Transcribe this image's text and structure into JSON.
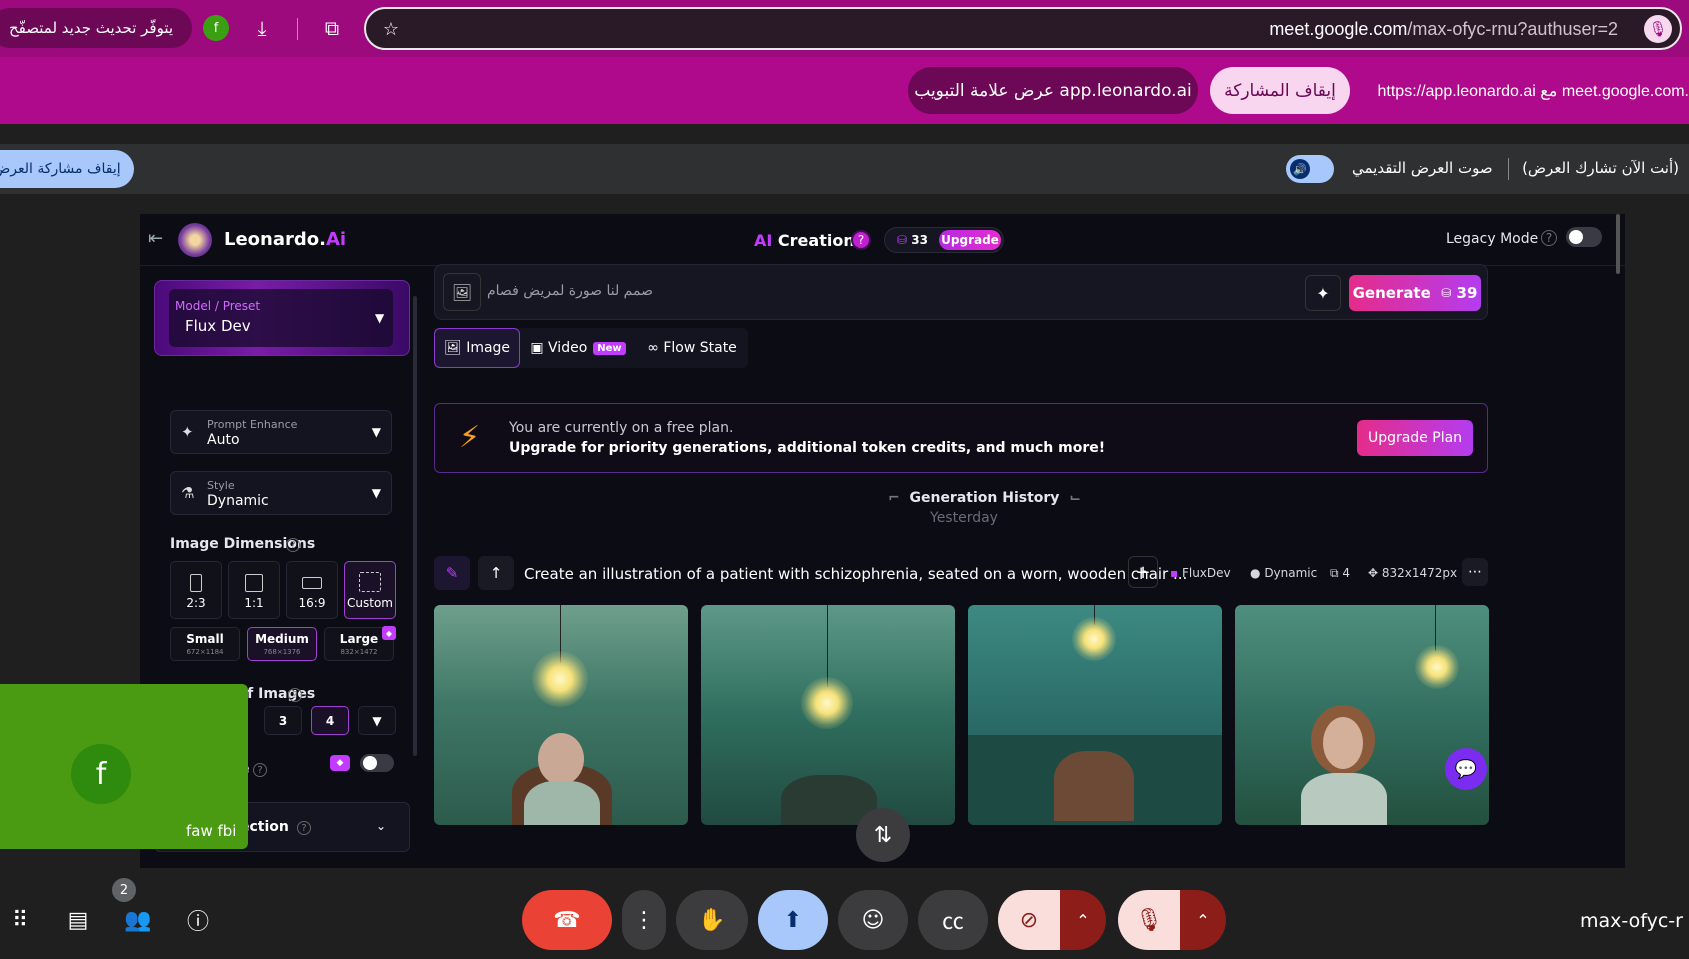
{
  "browser": {
    "update_text": "يتوفّر تحديث جديد لمتصفّح",
    "profile_initial": "f",
    "url_host": "meet.google.com",
    "url_path": "/max-ofyc-rnu?authuser=2"
  },
  "share_bar": {
    "info": "https://app.leonardo.ai مع meet.google.com.",
    "stop_button": "إيقاف المشاركة",
    "show_tab_button": "عرض علامة التبويب app.leonardo.ai"
  },
  "meet_strip": {
    "stop_presenting": "إيقاف مشاركة العرض",
    "presenting_text": "(أنت الآن تشارك العرض)",
    "presentation_audio": "صوت العرض التقديمي"
  },
  "leonardo": {
    "brand_main": "Leonardo.",
    "brand_ai": "Ai",
    "creation_ai": "AI",
    "creation": " Creation",
    "help_mark": "?",
    "tokens": "33",
    "upgrade": "Upgrade",
    "legacy_mode": "Legacy Mode",
    "sidebar": {
      "model_label": "Model / Preset",
      "model_value": "Flux Dev",
      "prompt_enhance_label": "Prompt Enhance",
      "prompt_enhance_value": "Auto",
      "style_label": "Style",
      "style_value": "Dynamic",
      "image_dimensions": "Image Dimensions",
      "ratios": [
        "2:3",
        "1:1",
        "16:9",
        "Custom"
      ],
      "sizes": [
        {
          "name": "Small",
          "dims": "672×1184"
        },
        {
          "name": "Medium",
          "dims": "768×1376"
        },
        {
          "name": "Large",
          "dims": "832×1472"
        }
      ],
      "number_of_images": "Number of Images",
      "num_options": [
        "3",
        "4"
      ],
      "private_label": "e",
      "content_section": "ection"
    },
    "prompt": {
      "placeholder": "صمم لنا صورة لمريض فصام",
      "generate": "Generate",
      "generate_cost": "39"
    },
    "tabs": [
      {
        "label": "Image"
      },
      {
        "label": "Video",
        "badge": "New"
      },
      {
        "label": "Flow State"
      }
    ],
    "banner": {
      "line1": "You are currently on a free plan.",
      "line2": "Upgrade for priority generations, additional token credits, and much more!",
      "button": "Upgrade Plan"
    },
    "history": {
      "title": "Generation History",
      "day": "Yesterday",
      "prompt": "Create an illustration of a patient with schizophrenia, seated on a worn, wooden chair ...",
      "model": "FluxDev",
      "style": "Dynamic",
      "count": "4",
      "dims": "832x1472px"
    }
  },
  "self_tile": {
    "initial": "f",
    "name": "faw fbi"
  },
  "bottom": {
    "people_count": "2",
    "meeting_code": "max-ofyc-r"
  },
  "colors": {
    "chrome": "#9c0a7d",
    "share_bar": "#ae0a8b",
    "accent": "#c33bff",
    "end_call": "#ea4335"
  }
}
